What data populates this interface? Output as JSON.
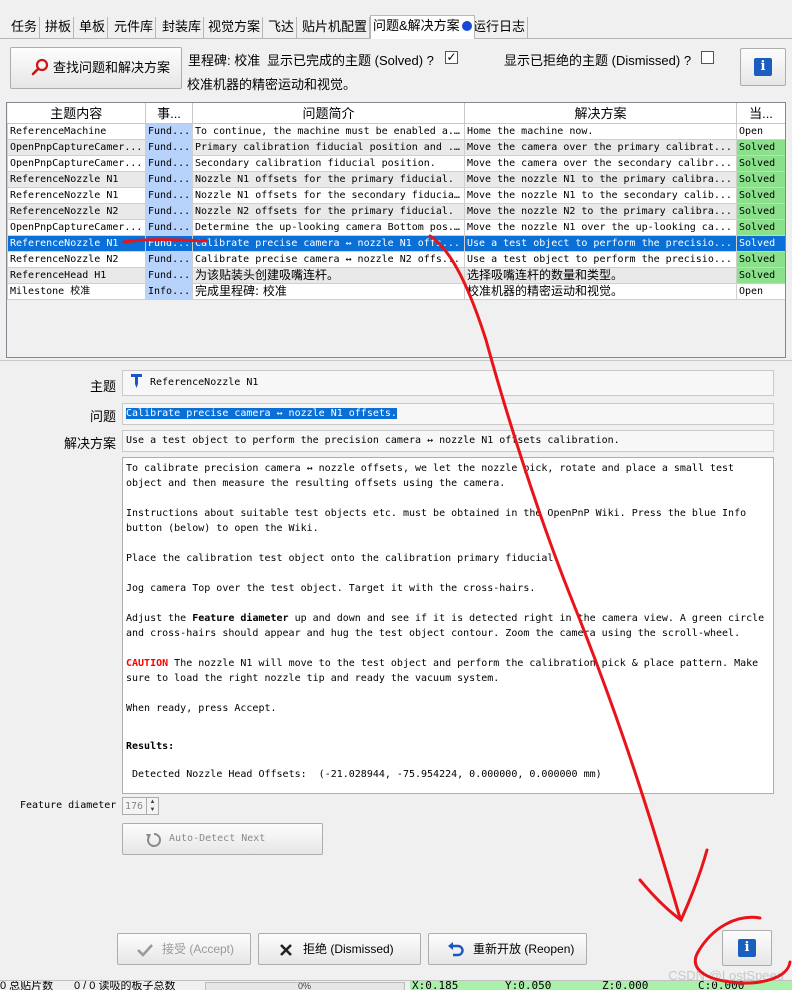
{
  "tabs": [
    {
      "label": "任务"
    },
    {
      "label": "拼板"
    },
    {
      "label": "单板"
    },
    {
      "label": "元件库"
    },
    {
      "label": "封装库"
    },
    {
      "label": "视觉方案"
    },
    {
      "label": "飞达"
    },
    {
      "label": "贴片机配置"
    },
    {
      "label": "问题&解决方案"
    },
    {
      "label": "运行日志"
    }
  ],
  "toolbar": {
    "find_button_label": "查找问题和解决方案",
    "find_button_icon": "magnifier-icon",
    "milestone_label": "里程碑: 校准",
    "show_solved_label": "显示已完成的主题 (Solved) ?",
    "show_solved_checked": true,
    "show_dismissed_label": "显示已拒绝的主题 (Dismissed) ?",
    "show_dismissed_checked": false,
    "milestone_description": "校准机器的精密运动和视觉。",
    "info_icon": "info-icon"
  },
  "table": {
    "columns": [
      "主题内容",
      "事...",
      "问题简介",
      "解决方案",
      "当..."
    ],
    "rows": [
      {
        "subject": "ReferenceMachine",
        "cat": "Fund...",
        "issue": "To continue, the machine must be enabled a...",
        "solution": "Home the machine now.",
        "state": "Open"
      },
      {
        "subject": "OpenPnpCaptureCamer...",
        "cat": "Fund...",
        "issue": "Primary calibration fiducial position and ...",
        "solution": "Move the camera over the primary calibrat...",
        "state": "Solved"
      },
      {
        "subject": "OpenPnpCaptureCamer...",
        "cat": "Fund...",
        "issue": "Secondary calibration fiducial position.",
        "solution": "Move the camera over the secondary calibr...",
        "state": "Solved"
      },
      {
        "subject": "ReferenceNozzle N1",
        "cat": "Fund...",
        "issue": "Nozzle N1 offsets for the primary fiducial.",
        "solution": "Move the nozzle N1 to the primary calibra...",
        "state": "Solved"
      },
      {
        "subject": "ReferenceNozzle N1",
        "cat": "Fund...",
        "issue": "Nozzle N1 offsets for the secondary fiducial.",
        "solution": "Move the nozzle N1 to the secondary calib...",
        "state": "Solved"
      },
      {
        "subject": "ReferenceNozzle N2",
        "cat": "Fund...",
        "issue": "Nozzle N2 offsets for the primary fiducial.",
        "solution": "Move the nozzle N2 to the primary calibra...",
        "state": "Solved"
      },
      {
        "subject": "OpenPnpCaptureCamer...",
        "cat": "Fund...",
        "issue": "Determine the up-looking camera Bottom pos...",
        "solution": "Move the nozzle N1 over the up-looking ca...",
        "state": "Solved"
      },
      {
        "subject": "ReferenceNozzle N1",
        "cat": "Fund...",
        "issue": "Calibrate precise camera ↔ nozzle N1 offs...",
        "solution": "Use a test object to perform the precisio...",
        "state": "Solved"
      },
      {
        "subject": "ReferenceNozzle N2",
        "cat": "Fund...",
        "issue": "Calibrate precise camera ↔ nozzle N2 offs...",
        "solution": "Use a test object to perform the precisio...",
        "state": "Solved"
      },
      {
        "subject": "ReferenceHead H1",
        "cat": "Fund...",
        "issue": "为该贴装头创建吸嘴连杆。",
        "solution": "选择吸嘴连杆的数量和类型。",
        "state": "Solved"
      },
      {
        "subject": "Milestone 校准",
        "cat": "Info...",
        "issue": "完成里程碑: 校准",
        "solution": "校准机器的精密运动和视觉。",
        "state": "Open"
      }
    ]
  },
  "detail": {
    "subject_label": "主题",
    "subject_value": "ReferenceNozzle N1",
    "issue_label": "问题",
    "issue_value": "Calibrate precise camera ↔ nozzle N1 offsets.",
    "solution_label": "解决方案",
    "solution_value": "Use a test object to perform the precision camera ↔ nozzle N1 offsets calibration.",
    "desc_p1": "To calibrate precision camera ↔ nozzle offsets, we let the nozzle pick, rotate and place a small test object and then measure the resulting offsets using the camera.",
    "desc_p2": "Instructions about suitable test objects etc. must be obtained in the OpenPnP Wiki. Press the blue Info button (below) to open the Wiki.",
    "desc_p3": "Place the calibration test object onto the calibration primary fiducial.",
    "desc_p4": "Jog camera Top over the test object. Target it with the cross-hairs.",
    "desc_p5a": "Adjust the ",
    "desc_p5b": "Feature diameter",
    "desc_p5c": " up and down and see if it is detected right in the camera view. A green circle and cross-hairs should appear and hug the test object contour. Zoom the camera using the scroll-wheel.",
    "desc_p6a": "CAUTION",
    "desc_p6b": " The nozzle N1 will move to the test object and perform the calibration pick & place pattern. Make sure to load the right nozzle tip and ready the vacuum system.",
    "desc_p7": "When ready, press Accept.",
    "results_label": "Results:",
    "results_value": " Detected Nozzle Head Offsets:  (-21.028944, -75.954224, 0.000000, 0.000000 mm)",
    "feature_diameter_label": "Feature diameter",
    "feature_diameter_value": "176",
    "auto_detect_label": "Auto-Detect Next"
  },
  "buttons": {
    "accept_label": "接受 (Accept)",
    "dismiss_label": "拒绝 (Dismissed)",
    "reopen_label": "重新开放 (Reopen)"
  },
  "status": {
    "left_text": "0 总贴片数",
    "count_text": "0 / 0 读吸的板子总数",
    "progress_text": "0%",
    "progress": 0,
    "x": "X:0.185",
    "y": "Y:0.050",
    "z": "Z:0.000",
    "c": "C:0.000"
  },
  "watermark": "CSDN @LostSpeed",
  "colors": {
    "accent": "#0a6fd7",
    "solved": "#8be08b",
    "category": "#b7d2fb",
    "annotation": "#e8141a"
  }
}
